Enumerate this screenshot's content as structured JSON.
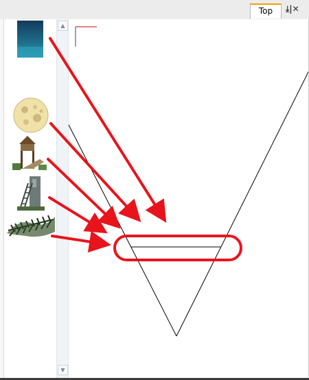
{
  "window": {
    "tab_label": "Top",
    "tab_controls": "⤓|✕"
  },
  "thumbnails": [
    {
      "name": "sea-thumbnail"
    },
    {
      "name": "moon-thumbnail"
    },
    {
      "name": "watchtower-thumbnail"
    },
    {
      "name": "ladder-thumbnail"
    },
    {
      "name": "bush-thumbnail"
    }
  ],
  "colors": {
    "annotation_red": "#e8141c",
    "axis_red": "#cc0000",
    "axis_blue": "#3333cc",
    "tab_accent": "#f0a000"
  },
  "icons": {
    "scroll_up": "chevron-up-icon",
    "scroll_down": "chevron-down-icon"
  }
}
